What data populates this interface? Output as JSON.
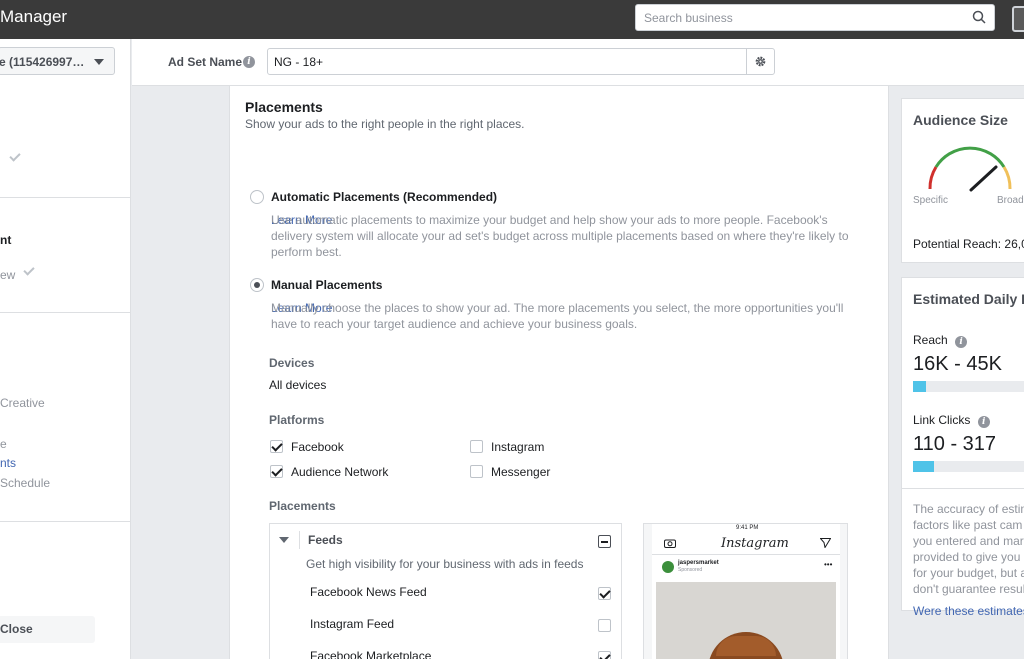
{
  "topbar": {
    "app_title": "Manager",
    "search_placeholder": "Search business"
  },
  "left": {
    "account_label": "e (115426997…",
    "step_label_1": "nt",
    "step_label_2": "ew",
    "step_creative": "Creative",
    "step_e": "e",
    "step_placements": "nts",
    "step_schedule": "Schedule",
    "close_label": "Close"
  },
  "adset": {
    "label": "Ad Set Name",
    "value": "NG - 18+"
  },
  "placements": {
    "title": "Placements",
    "subtitle": "Show your ads to the right people in the right places.",
    "auto_label": "Automatic Placements (Recommended)",
    "auto_desc": "Use automatic placements to maximize your budget and help show your ads to more people. Facebook's delivery system will allocate your ad set's budget across multiple placements based on where they're likely to perform best.",
    "learn_more": "Learn More",
    "manual_label": "Manual Placements",
    "manual_desc": "Manually choose the places to show your ad. The more placements you select, the more opportunities you'll have to reach your target audience and achieve your business goals.",
    "devices_label": "Devices",
    "devices_value": "All devices",
    "platforms_label": "Platforms",
    "platforms": {
      "facebook": "Facebook",
      "instagram": "Instagram",
      "audience_network": "Audience Network",
      "messenger": "Messenger"
    },
    "placements_label": "Placements",
    "feeds": {
      "label": "Feeds",
      "subtitle": "Get high visibility for your business with ads in feeds",
      "items": [
        "Facebook News Feed",
        "Instagram Feed",
        "Facebook Marketplace"
      ]
    }
  },
  "preview": {
    "time": "9:41 PM",
    "app": "Instagram",
    "handle": "jaspersmarket",
    "sponsored": "Sponsored"
  },
  "audience": {
    "title": "Audience Size",
    "specific": "Specific",
    "broad": "Broad",
    "potential_reach": "Potential Reach: 26,0"
  },
  "daily": {
    "title": "Estimated Daily Re",
    "reach_label": "Reach",
    "reach_value": "16K - 45K",
    "reach_fraction": 0.1,
    "clicks_label": "Link Clicks",
    "clicks_value": "110 - 317",
    "clicks_fraction": 0.16,
    "disclaimer_lines": [
      "The accuracy of estim",
      "factors like past cam",
      "you entered and mark",
      "provided to give you a",
      "for your budget, but a",
      "don't guarantee resul"
    ],
    "were_these": "Were these estimates"
  },
  "colors": {
    "accent": "#4267b2",
    "bar_fill": "#4fc3e8",
    "topbar": "#3a3a3a"
  }
}
